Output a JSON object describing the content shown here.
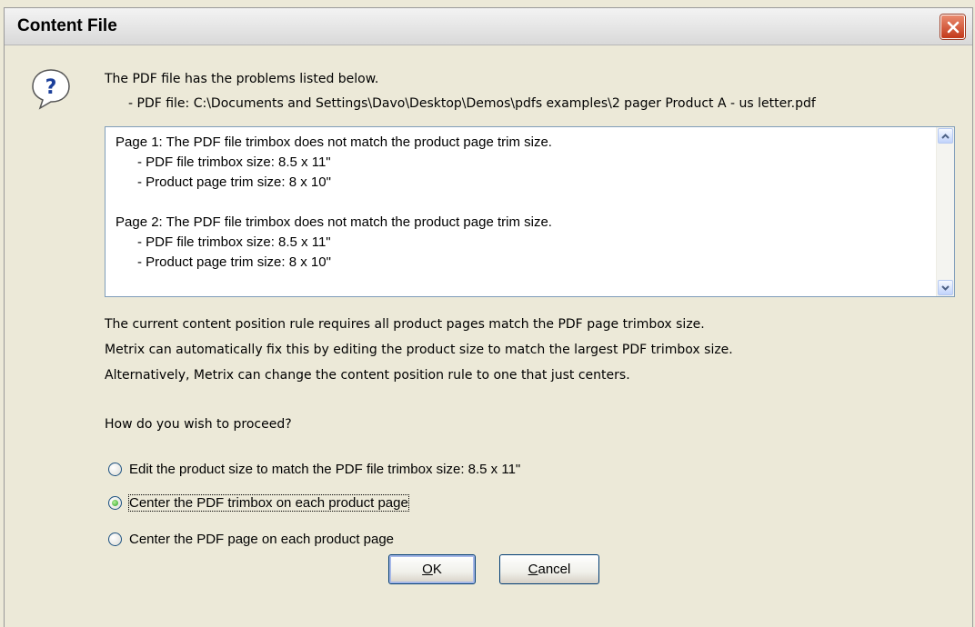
{
  "dialog": {
    "title": "Content File",
    "intro": "The PDF file has the problems listed below.",
    "pdf_file_line": "- PDF file: C:\\Documents and Settings\\Davo\\Desktop\\Demos\\pdfs examples\\2 pager Product A - us letter.pdf",
    "problems": [
      "Page 1: The PDF file trimbox does not match the product page trim size.",
      "- PDF file trimbox size: 8.5 x 11\"",
      "- Product page trim size: 8 x 10\"",
      "",
      "Page 2: The PDF file trimbox does not match the product page trim size.",
      "- PDF file trimbox size: 8.5 x 11\"",
      "- Product page trim size: 8 x 10\""
    ],
    "explanation": [
      "The current content position rule requires all product pages match the PDF page trimbox size.",
      "Metrix can automatically fix this by editing the product size to match the largest PDF trimbox size.",
      "Alternatively, Metrix can change the content position rule to one that just centers."
    ],
    "question": "How do you wish to proceed?",
    "options": [
      {
        "label": "Edit the product size to match the PDF file trimbox size: 8.5 x 11\"",
        "selected": false
      },
      {
        "label": "Center the PDF trimbox on each product page",
        "selected": true
      },
      {
        "label": "Center the PDF page on each product page",
        "selected": false
      }
    ],
    "ok_mnemonic": "O",
    "ok_rest": "K",
    "cancel_mnemonic": "C",
    "cancel_rest": "ancel"
  },
  "icons": {
    "dialog": "question-icon",
    "close": "close-icon",
    "scroll_up": "chevron-up-icon",
    "scroll_down": "chevron-down-icon"
  },
  "colors": {
    "close_button": "#c2391b",
    "radio_selected": "#21a121",
    "list_border": "#7f9db9"
  }
}
